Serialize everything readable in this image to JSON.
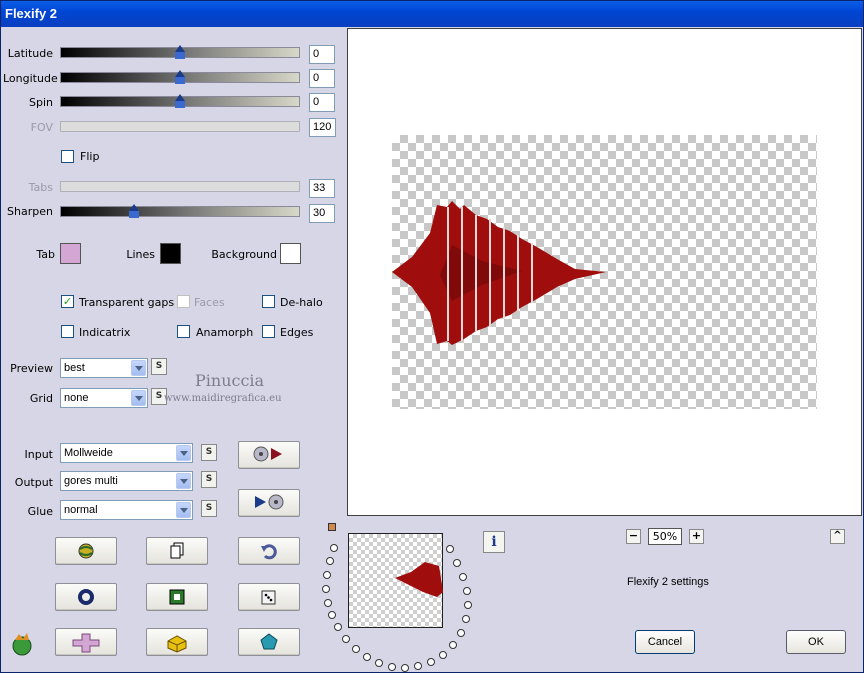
{
  "window": {
    "title": "Flexify 2"
  },
  "sliders": [
    {
      "label": "Latitude",
      "value": "0",
      "level": 0.5,
      "enabled": true
    },
    {
      "label": "Longitude",
      "value": "0",
      "level": 0.5,
      "enabled": true
    },
    {
      "label": "Spin",
      "value": "0",
      "level": 0.5,
      "enabled": true
    },
    {
      "label": "FOV",
      "value": "120",
      "enabled": false
    },
    {
      "label": "Tabs",
      "value": "33",
      "enabled": false
    },
    {
      "label": "Sharpen",
      "value": "30",
      "level": 0.3,
      "enabled": true
    }
  ],
  "flip": {
    "label": "Flip",
    "checked": false
  },
  "colors": {
    "tab": {
      "label": "Tab",
      "color": "#d4a6d4"
    },
    "lines": {
      "label": "Lines",
      "color": "#000000"
    },
    "background": {
      "label": "Background",
      "color": "#ffffff"
    }
  },
  "options": {
    "transparent_gaps": {
      "label": "Transparent gaps",
      "checked": true
    },
    "faces": {
      "label": "Faces",
      "checked": false,
      "enabled": false
    },
    "de_halo": {
      "label": "De-halo",
      "checked": false
    },
    "indicatrix": {
      "label": "Indicatrix",
      "checked": false
    },
    "anamorph": {
      "label": "Anamorph",
      "checked": false
    },
    "edges": {
      "label": "Edges",
      "checked": false
    }
  },
  "preview_select": {
    "label": "Preview",
    "value": "best"
  },
  "grid_select": {
    "label": "Grid",
    "value": "none"
  },
  "watermark": {
    "name": "Pinuccia",
    "url": "www.maidiregrafica.eu"
  },
  "input_select": {
    "label": "Input",
    "value": "Mollweide"
  },
  "output_select": {
    "label": "Output",
    "value": "gores multi"
  },
  "glue_select": {
    "label": "Glue",
    "value": "normal"
  },
  "small_button_label": "S",
  "zoom": {
    "value": "50%",
    "minus": "−",
    "plus": "+"
  },
  "info_label": "i",
  "collapse_label": "^",
  "settings_name": "Flexify 2 settings",
  "buttons": {
    "cancel": "Cancel",
    "ok": "OK"
  },
  "colors_ui": {
    "shape": "#a00d0d",
    "shape_dark": "#6a0606"
  }
}
